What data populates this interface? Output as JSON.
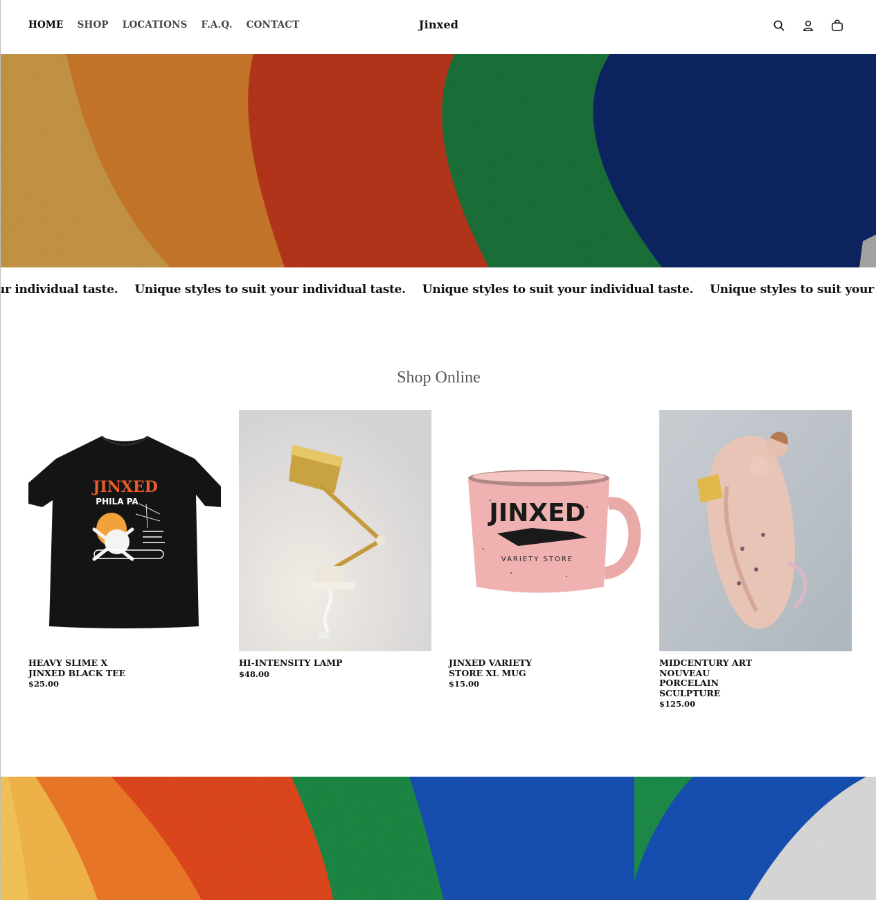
{
  "header": {
    "nav": [
      "HOME",
      "SHOP",
      "LOCATIONS",
      "F.A.Q.",
      "CONTACT"
    ],
    "logo": "Jinxed",
    "icons": [
      "search-icon",
      "account-icon",
      "cart-icon"
    ]
  },
  "marquee": {
    "items": [
      "Unique styles to suit your individual taste.",
      "Unique styles to suit your individual taste.",
      "Unique styles to suit your individual taste.",
      "Unique styles to suit your individual taste."
    ]
  },
  "shop": {
    "title": "Shop Online",
    "products": [
      {
        "name": "HEAVY SLIME X JINXED BLACK TEE",
        "price": "$25.00"
      },
      {
        "name": "HI-INTENSITY LAMP",
        "price": "$48.00"
      },
      {
        "name": "JINXED VARIETY STORE XL MUG",
        "price": "$15.00"
      },
      {
        "name": "MIDCENTURY ART NOUVEAU PORCELAIN SCULPTURE",
        "price": "$125.00"
      }
    ],
    "tee_print": {
      "line1": "JINXED",
      "line2": "PHILA PA"
    },
    "mug_print": {
      "line1": "JINXED",
      "line2": "VARIETY STORE"
    }
  },
  "colors": {
    "yellow": "#e2a84a",
    "orange": "#e0772c",
    "red": "#d4401e",
    "green": "#1f8a45",
    "blue": "#13307a",
    "bright_blue": "#1451b5"
  }
}
